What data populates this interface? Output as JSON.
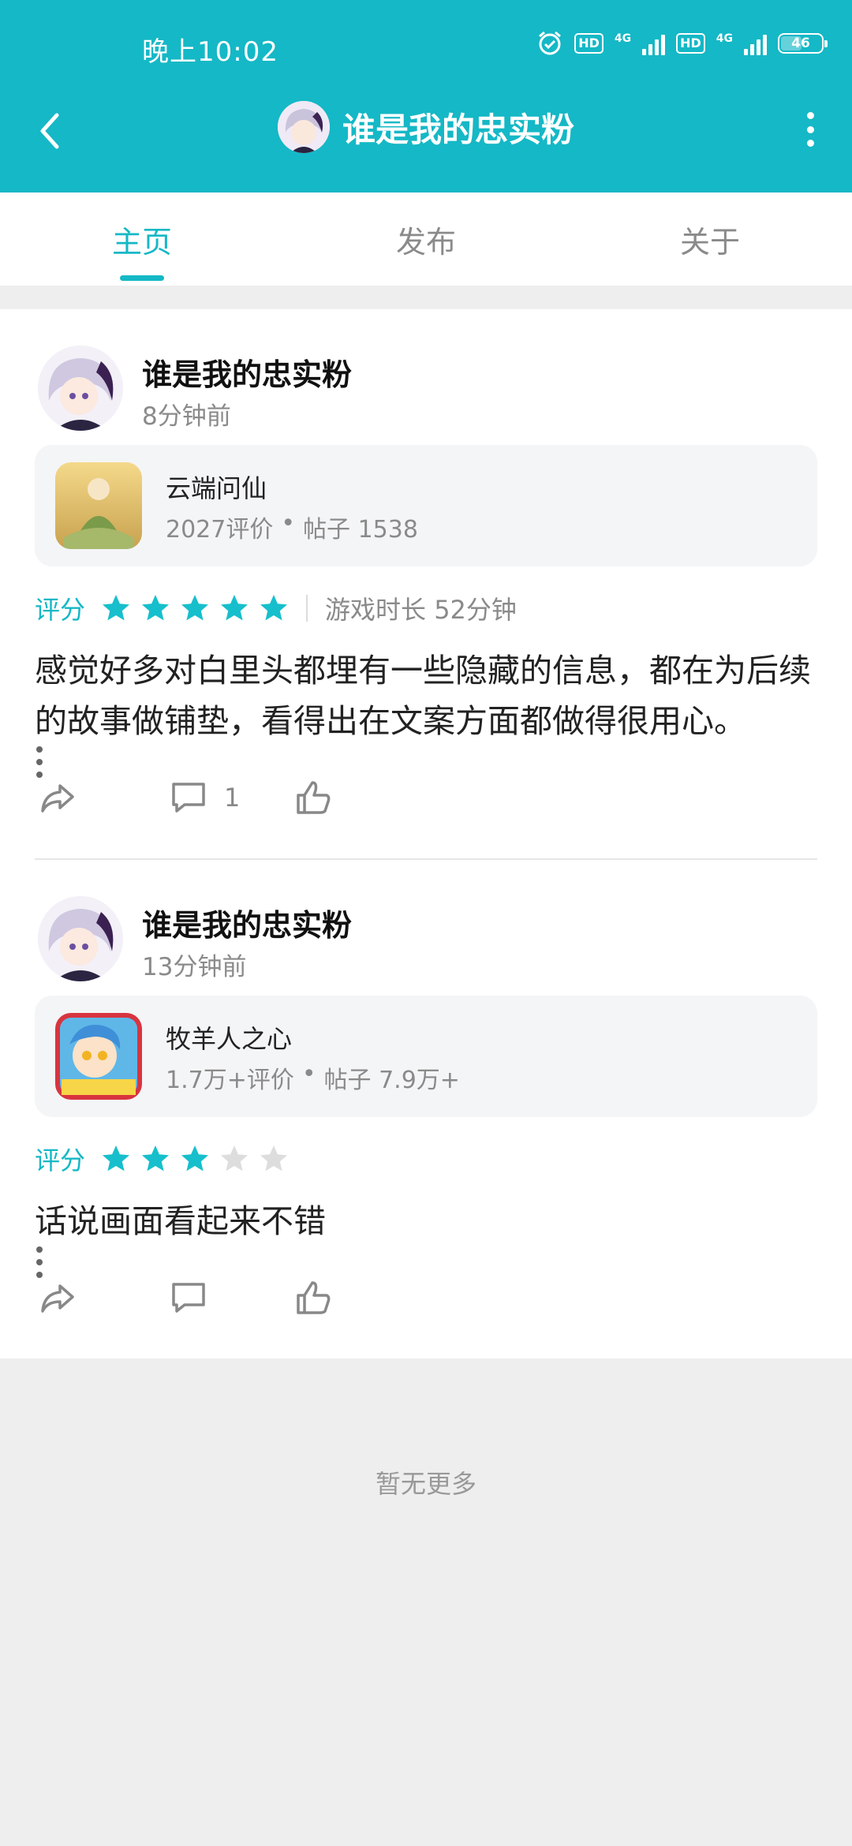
{
  "status_bar": {
    "time": "晚上10:02",
    "hd1": "HD",
    "net1": "4G",
    "hd2": "HD",
    "net2": "4G",
    "battery": "46"
  },
  "header": {
    "title": "谁是我的忠实粉"
  },
  "tabs": [
    {
      "label": "主页",
      "active": true
    },
    {
      "label": "发布",
      "active": false
    },
    {
      "label": "关于",
      "active": false
    }
  ],
  "posts": [
    {
      "author": "谁是我的忠实粉",
      "time": "8分钟前",
      "game": {
        "name": "云端问仙",
        "reviews": "2027评价",
        "posts": "帖子 1538"
      },
      "rating_label": "评分",
      "stars": 5,
      "playtime": "游戏时长 52分钟",
      "body": "感觉好多对白里头都埋有一些隐藏的信息，都在为后续的故事做铺垫，看得出在文案方面都做得很用心。",
      "comment_count": "1"
    },
    {
      "author": "谁是我的忠实粉",
      "time": "13分钟前",
      "game": {
        "name": "牧羊人之心",
        "reviews": "1.7万+评价",
        "posts": "帖子 7.9万+"
      },
      "rating_label": "评分",
      "stars": 3,
      "playtime": "",
      "body": "话说画面看起来不错",
      "comment_count": ""
    }
  ],
  "footer": {
    "no_more": "暂无更多"
  },
  "colors": {
    "accent": "#15b8c6",
    "star_on": "#17bfcc",
    "star_off": "#dddddd"
  }
}
